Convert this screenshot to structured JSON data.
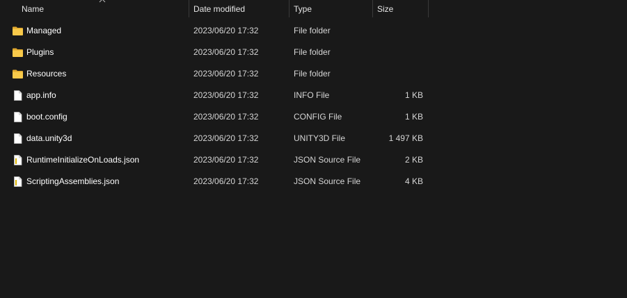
{
  "columns": {
    "name": "Name",
    "date": "Date modified",
    "type": "Type",
    "size": "Size"
  },
  "sort": {
    "column": "name",
    "direction": "ascending",
    "icon": "chevron-up-icon"
  },
  "colors": {
    "background": "#191919",
    "folder": "#f4c542",
    "text": "#ffffff",
    "divider": "#3a3a3a"
  },
  "files": [
    {
      "name": "Managed",
      "date": "2023/06/20 17:32",
      "type": "File folder",
      "size": "",
      "icon": "folder-icon"
    },
    {
      "name": "Plugins",
      "date": "2023/06/20 17:32",
      "type": "File folder",
      "size": "",
      "icon": "folder-icon"
    },
    {
      "name": "Resources",
      "date": "2023/06/20 17:32",
      "type": "File folder",
      "size": "",
      "icon": "folder-icon"
    },
    {
      "name": "app.info",
      "date": "2023/06/20 17:32",
      "type": "INFO File",
      "size": "1 KB",
      "icon": "file-icon"
    },
    {
      "name": "boot.config",
      "date": "2023/06/20 17:32",
      "type": "CONFIG File",
      "size": "1 KB",
      "icon": "file-icon"
    },
    {
      "name": "data.unity3d",
      "date": "2023/06/20 17:32",
      "type": "UNITY3D File",
      "size": "1 497 KB",
      "icon": "file-icon"
    },
    {
      "name": "RuntimeInitializeOnLoads.json",
      "date": "2023/06/20 17:32",
      "type": "JSON Source File",
      "size": "2 KB",
      "icon": "json-file-icon"
    },
    {
      "name": "ScriptingAssemblies.json",
      "date": "2023/06/20 17:32",
      "type": "JSON Source File",
      "size": "4 KB",
      "icon": "json-file-icon"
    }
  ]
}
